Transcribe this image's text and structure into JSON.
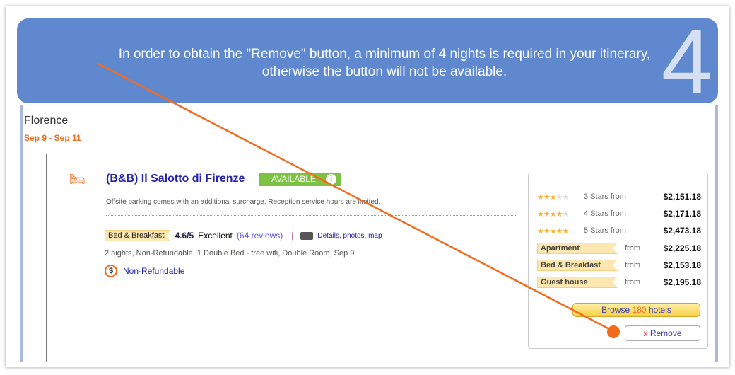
{
  "banner": {
    "message": "In order to obtain the \"Remove\" button, a minimum of 4 nights is required in your itinerary, otherwise the button will not be available.",
    "step_number": "4"
  },
  "city": "Florence",
  "dates": "Sep 9 - Sep 11",
  "hotel": {
    "name": "(B&B) Il Salotto di Firenze",
    "status": "AVAILABLE",
    "note": "Offsite parking comes with an additional surcharge. Reception service hours are limited.",
    "type": "Bed & Breakfast",
    "score": "4.6/5",
    "rating_text": "Excellent",
    "reviews": "(64 reviews)",
    "separator": "|",
    "details_link": "Details, photos, map",
    "description": "2 nights, Non-Refundable, 1 Double Bed - free wifi, Double Room, Sep 9",
    "refund_policy": "Non-Refundable",
    "refund_icon": "$"
  },
  "sidebar": {
    "star_rows": [
      {
        "stars": 3,
        "label": "3 Stars from",
        "price": "$2,151.18"
      },
      {
        "stars": 4,
        "label": "4 Stars from",
        "price": "$2,171.18"
      },
      {
        "stars": 5,
        "label": "5 Stars from",
        "price": "$2,473.18"
      }
    ],
    "type_rows": [
      {
        "type": "Apartment",
        "from": "from",
        "price": "$2,225.18"
      },
      {
        "type": "Bed & Breakfast",
        "from": "from",
        "price": "$2,153.18"
      },
      {
        "type": "Guest house",
        "from": "from",
        "price": "$2,195.18"
      }
    ],
    "browse": {
      "prefix": "Browse",
      "count": "180",
      "suffix": "hotels"
    },
    "remove": {
      "x": "x",
      "label": "Remove"
    }
  },
  "colors": {
    "banner": "#5f88cf",
    "accent": "#f26b1d",
    "link": "#2222aa",
    "available": "#7dc243"
  }
}
